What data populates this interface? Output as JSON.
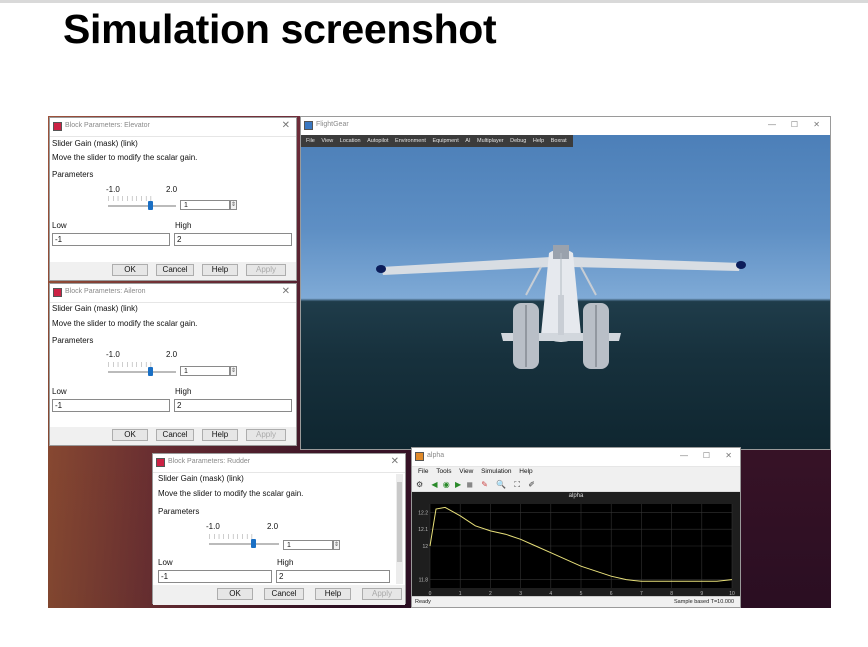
{
  "slide": {
    "title": "Simulation screenshot"
  },
  "dialog_labels": {
    "subtitle": "Slider Gain (mask) (link)",
    "desc": "Move the slider to modify the scalar gain.",
    "params": "Parameters",
    "low_label": "Low",
    "high_label": "High",
    "ok": "OK",
    "cancel": "Cancel",
    "help": "Help",
    "apply": "Apply",
    "spin_arrows": "⇕"
  },
  "dialogs": {
    "elevator": {
      "title": "Block Parameters: Elevator",
      "min": "-1.0",
      "max": "2.0",
      "value": "1",
      "low": "-1",
      "high": "2"
    },
    "aileron": {
      "title": "Block Parameters: Aileron",
      "min": "-1.0",
      "max": "2.0",
      "value": "1",
      "low": "-1",
      "high": "2"
    },
    "rudder": {
      "title": "Block Parameters: Rudder",
      "min": "-1.0",
      "max": "2.0",
      "value": "1",
      "low": "-1",
      "high": "2"
    }
  },
  "flightgear": {
    "title": "FlightGear",
    "menu": [
      "File",
      "View",
      "Location",
      "Autopilot",
      "Environment",
      "Equipment",
      "AI",
      "Multiplayer",
      "Debug",
      "Help",
      "Boxrat"
    ],
    "controls": {
      "min": "—",
      "max": "☐",
      "close": "✕"
    }
  },
  "scope": {
    "title": "alpha",
    "menu": [
      "File",
      "Tools",
      "View",
      "Simulation",
      "Help"
    ],
    "plot_title": "alpha",
    "status_left": "Ready",
    "status_right": "Sample based   T=10.000",
    "controls": {
      "min": "—",
      "max": "☐",
      "close": "✕"
    }
  },
  "chart_data": {
    "type": "line",
    "title": "alpha",
    "xlabel": "",
    "ylabel": "",
    "xlim": [
      0,
      10
    ],
    "ylim": [
      11.75,
      12.25
    ],
    "x_ticks": [
      "0",
      "1",
      "2",
      "3",
      "4",
      "5",
      "6",
      "7",
      "8",
      "9",
      "10"
    ],
    "y_ticks": [
      "11.8",
      "12",
      "12.1",
      "12.2"
    ],
    "grid": true,
    "series": [
      {
        "color": "#e8e07a",
        "x": [
          0,
          0.2,
          0.5,
          1,
          1.5,
          2,
          2.5,
          3,
          3.5,
          4,
          4.5,
          5,
          5.5,
          6,
          6.5,
          7,
          7.5,
          8,
          8.5,
          9,
          9.5,
          10
        ],
        "y": [
          12.0,
          12.22,
          12.23,
          12.18,
          12.12,
          12.09,
          12.07,
          12.04,
          12.0,
          11.96,
          11.92,
          11.88,
          11.85,
          11.82,
          11.8,
          11.79,
          11.79,
          11.79,
          11.79,
          11.79,
          11.79,
          11.8
        ]
      }
    ]
  }
}
